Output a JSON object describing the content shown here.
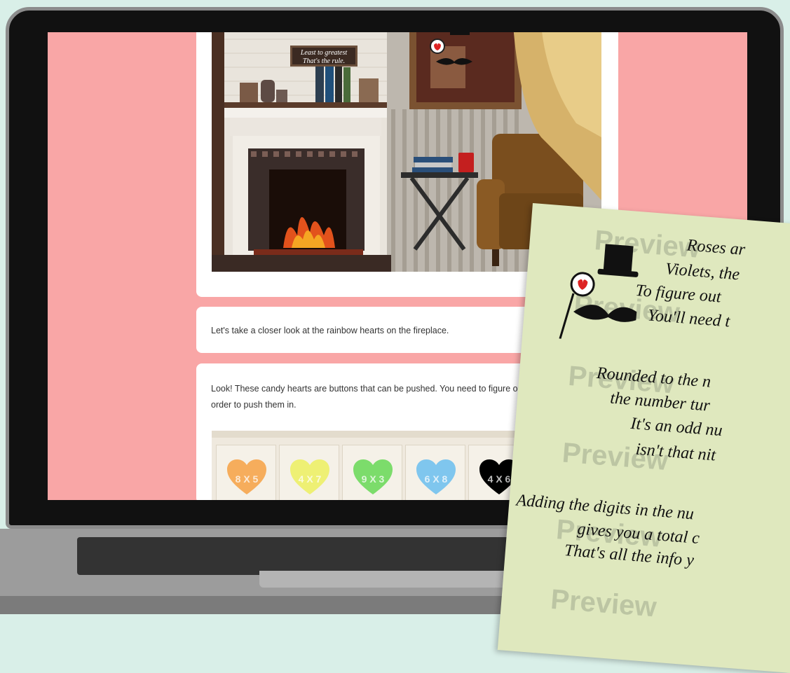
{
  "scene": {
    "sign_line1": "Least to greatest",
    "sign_line2": "That's the rule."
  },
  "form": {
    "text1": "Let's take a closer look at the rainbow hearts on the fireplace.",
    "text2": "Look! These candy hearts are buttons that can be pushed. You need to figure out what order to push them in.",
    "hearts": [
      {
        "label": "8 X 5",
        "color": "#f27f86"
      },
      {
        "label": "4 X 7",
        "color": "#f6ad5c"
      },
      {
        "label": "9 X 3",
        "color": "#eef074"
      },
      {
        "label": "6 X 8",
        "color": "#7cdc6b"
      },
      {
        "label": "4 X 6",
        "color": "#7fc6ee"
      }
    ]
  },
  "note": {
    "watermark": "Preview",
    "lines": [
      "Roses ar",
      "Violets, the",
      "To figure out",
      "You'll need t",
      "Rounded to the n",
      "the number tur",
      "It's an odd nu",
      "isn't that nit",
      "Adding the digits in the nu",
      "gives you a total c",
      "That's all the info y"
    ]
  },
  "colors": {
    "screen_bg": "#f9a6a6",
    "note_bg": "#dfe8be",
    "page_bg": "#d9efe8"
  }
}
